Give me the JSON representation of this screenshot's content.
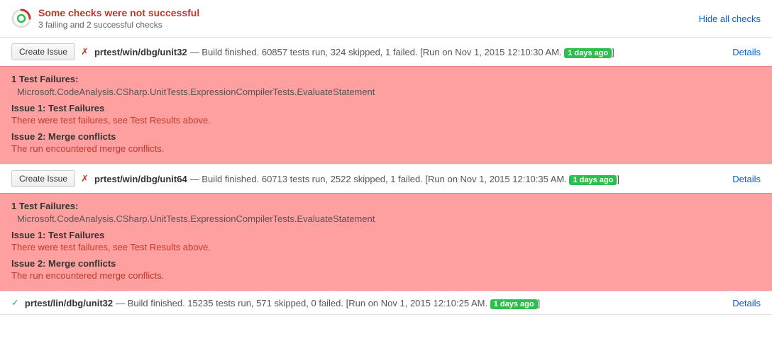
{
  "header": {
    "title": "Some checks were not successful",
    "subtitle": "3 failing and 2 successful checks",
    "hide_all_label": "Hide all checks"
  },
  "checks": [
    {
      "id": "check1",
      "create_issue_label": "Create Issue",
      "status": "fail",
      "status_icon": "✗",
      "name": "prtest/win/dbg/unit32",
      "description": "— Build finished. 60857 tests run, 324 skipped, 1 failed. [Run on Nov 1, 2015 12:10:30 AM.",
      "time_badge": "1 days ago",
      "details_label": "Details",
      "failures_header": "1 Test Failures:",
      "failure_item": "Microsoft.CodeAnalysis.CSharp.UnitTests.ExpressionCompilerTests.EvaluateStatement",
      "issues": [
        {
          "title": "Issue 1: Test Failures",
          "body": "There were test failures, see Test Results above."
        },
        {
          "title": "Issue 2: Merge conflicts",
          "body": "The run encountered merge conflicts."
        }
      ]
    },
    {
      "id": "check2",
      "create_issue_label": "Create Issue",
      "status": "fail",
      "status_icon": "✗",
      "name": "prtest/win/dbg/unit64",
      "description": "— Build finished. 60713 tests run, 2522 skipped, 1 failed. [Run on Nov 1, 2015 12:10:35 AM.",
      "time_badge": "1 days ago",
      "details_label": "Details",
      "failures_header": "1 Test Failures:",
      "failure_item": "Microsoft.CodeAnalysis.CSharp.UnitTests.ExpressionCompilerTests.EvaluateStatement",
      "issues": [
        {
          "title": "Issue 1: Test Failures",
          "body": "There were test failures, see Test Results above."
        },
        {
          "title": "Issue 2: Merge conflicts",
          "body": "The run encountered merge conflicts."
        }
      ]
    }
  ],
  "success_check": {
    "status": "success",
    "status_icon": "✓",
    "name": "prtest/lin/dbg/unit32",
    "description": "— Build finished. 15235 tests run, 571 skipped, 0 failed. [Run on Nov 1, 2015 12:10:25 AM.",
    "time_badge": "1 days ago",
    "details_label": "Details"
  }
}
